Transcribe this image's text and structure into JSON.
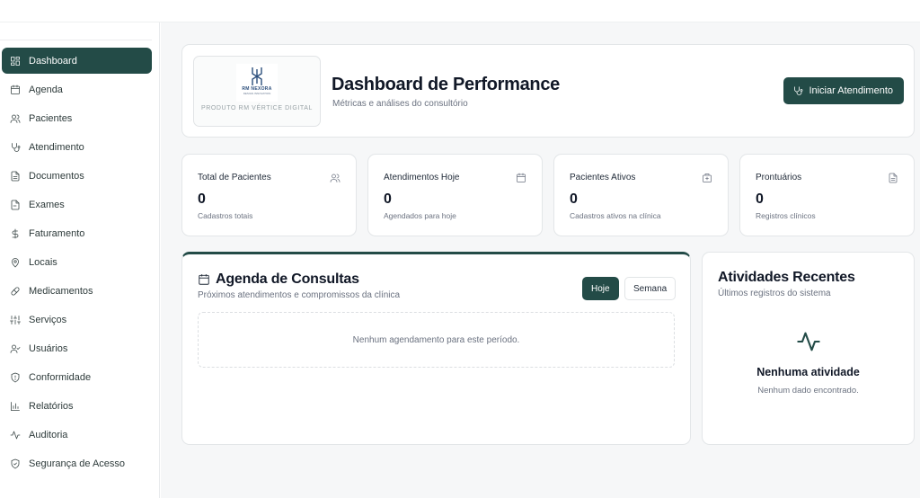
{
  "sidebar": {
    "items": [
      {
        "label": "Dashboard",
        "icon": "dashboard-grid-icon",
        "active": true
      },
      {
        "label": "Agenda",
        "icon": "calendar-icon"
      },
      {
        "label": "Pacientes",
        "icon": "users-icon"
      },
      {
        "label": "Atendimento",
        "icon": "stethoscope-icon"
      },
      {
        "label": "Documentos",
        "icon": "document-icon"
      },
      {
        "label": "Exames",
        "icon": "file-text-icon"
      },
      {
        "label": "Faturamento",
        "icon": "dollar-icon"
      },
      {
        "label": "Locais",
        "icon": "map-pin-icon"
      },
      {
        "label": "Medicamentos",
        "icon": "pill-icon"
      },
      {
        "label": "Serviços",
        "icon": "sliders-icon"
      },
      {
        "label": "Usuários",
        "icon": "user-check-icon"
      },
      {
        "label": "Conformidade",
        "icon": "shield-icon"
      },
      {
        "label": "Relatórios",
        "icon": "bar-chart-icon"
      },
      {
        "label": "Auditoria",
        "icon": "activity-icon"
      },
      {
        "label": "Segurança de Acesso",
        "icon": "shield-check-icon"
      }
    ]
  },
  "header": {
    "logo_brand": "RM NEXORA",
    "logo_brand_sub": "DESIGN INNOVATION",
    "logo_caption": "PRODUTO RM VÉRTICE DIGITAL",
    "title": "Dashboard de Performance",
    "subtitle": "Métricas e análises do consultório",
    "primary_button": "Iniciar Atendimento"
  },
  "stats": [
    {
      "label": "Total de Pacientes",
      "value": "0",
      "sub": "Cadastros totais",
      "icon": "users-icon"
    },
    {
      "label": "Atendimentos Hoje",
      "value": "0",
      "sub": "Agendados para hoje",
      "icon": "calendar-icon"
    },
    {
      "label": "Pacientes Ativos",
      "value": "0",
      "sub": "Cadastros ativos na clínica",
      "icon": "hospital-icon"
    },
    {
      "label": "Prontuários",
      "value": "0",
      "sub": "Registros clínicos",
      "icon": "file-text-icon"
    }
  ],
  "agenda": {
    "title": "Agenda de Consultas",
    "subtitle": "Próximos atendimentos e compromissos da clínica",
    "btn_today": "Hoje",
    "btn_week": "Semana",
    "empty": "Nenhum agendamento para este período."
  },
  "activity": {
    "title": "Atividades Recentes",
    "subtitle": "Últimos registros do sistema",
    "empty_title": "Nenhuma atividade",
    "empty_sub": "Nenhum dado encontrado."
  },
  "colors": {
    "accent": "#234b47",
    "background": "#f6f7f8"
  }
}
